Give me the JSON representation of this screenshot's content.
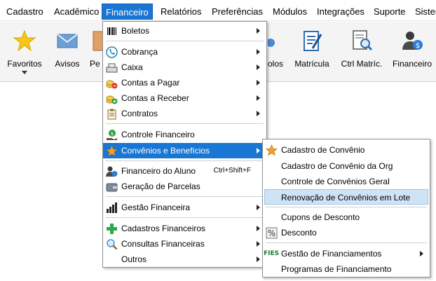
{
  "menubar": {
    "items": [
      "Cadastro",
      "Acadêmico",
      "Financeiro",
      "Relatórios",
      "Preferências",
      "Módulos",
      "Integrações",
      "Suporte",
      "Sistema"
    ]
  },
  "toolbar": {
    "buttons": [
      "Favoritos",
      "Avisos",
      "Pe",
      "olos",
      "Matrícula",
      "Ctrl Matríc.",
      "Financeiro"
    ]
  },
  "financeiro_menu": {
    "items": [
      {
        "label": "Boletos",
        "icon": "barcode-icon"
      },
      {
        "label": "Cobrança",
        "icon": "phone-icon"
      },
      {
        "label": "Caixa",
        "icon": "cash-register-icon"
      },
      {
        "label": "Contas a Pagar",
        "icon": "coins-minus-icon"
      },
      {
        "label": "Contas a Receber",
        "icon": "coins-plus-icon"
      },
      {
        "label": "Contratos",
        "icon": "clipboard-icon"
      },
      {
        "label": "Controle Financeiro",
        "icon": "money-hand-icon"
      },
      {
        "label": "Convênios e Benefícios",
        "icon": "star-icon"
      },
      {
        "label": "Financeiro do Aluno",
        "shortcut": "Ctrl+Shift+F",
        "icon": "student-money-icon"
      },
      {
        "label": "Geração de Parcelas",
        "icon": "wallet-icon"
      },
      {
        "label": "Gestão Financeira",
        "icon": "bar-chart-icon"
      },
      {
        "label": "Cadastros Financeiros",
        "icon": "green-plus-icon"
      },
      {
        "label": "Consultas Financeiras",
        "icon": "magnifier-icon"
      },
      {
        "label": "Outros",
        "icon": ""
      }
    ]
  },
  "convenios_menu": {
    "items": [
      {
        "label": "Cadastro de Convênio",
        "icon": "star-icon"
      },
      {
        "label": "Cadastro de Convênio da Org"
      },
      {
        "label": "Controle de Convênios Geral"
      },
      {
        "label": "Renovação de Convênios em Lote"
      },
      {
        "label": "Cupons de Desconto"
      },
      {
        "label": "Desconto",
        "icon": "percent-icon"
      },
      {
        "label": "Gestão de Financiamentos",
        "icon": "fies-logo",
        "logo_text": "FIES"
      },
      {
        "label": "Programas de Financiamento"
      }
    ]
  },
  "colors": {
    "highlight": "#1976d2",
    "hover": "#cfe3f7"
  }
}
